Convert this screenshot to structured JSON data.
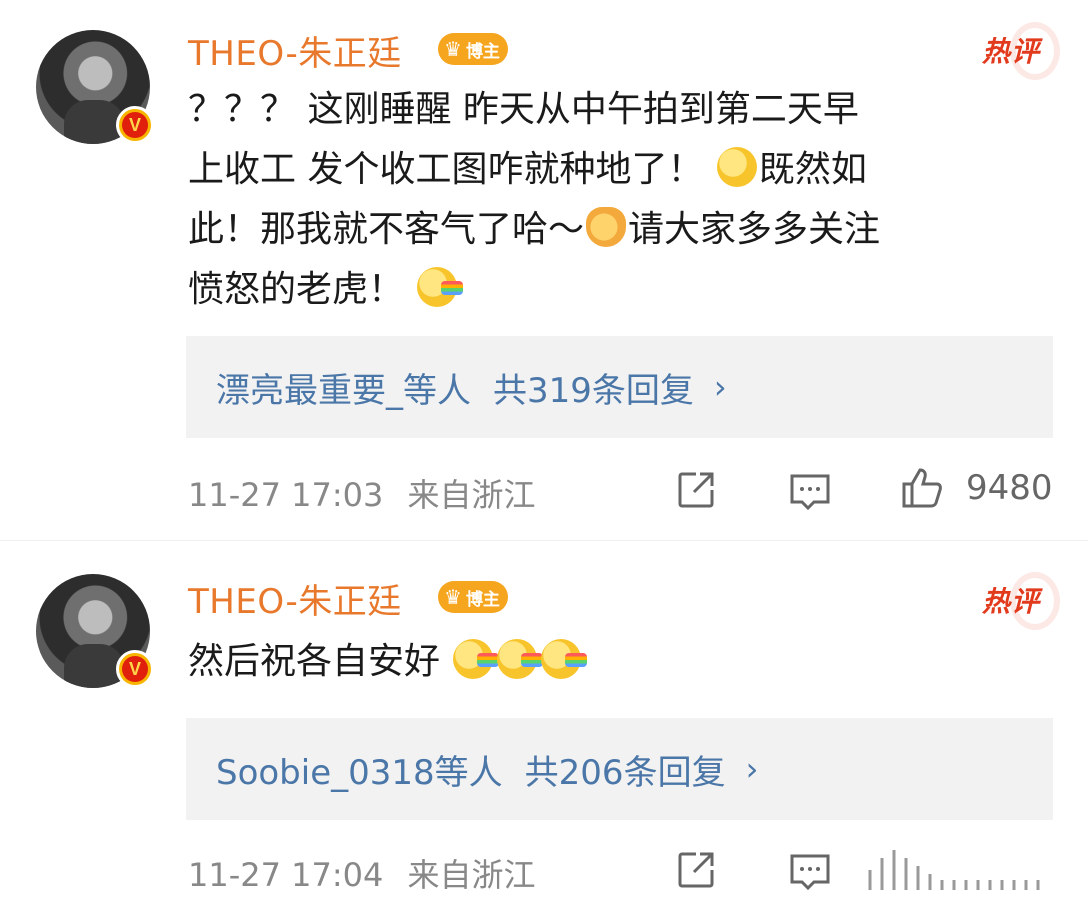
{
  "comments": [
    {
      "username": "THEO-朱正廷",
      "badge": "博主",
      "hot_tag": "热评",
      "text_lines": [
        "？？？ 这刚睡醒 昨天从中午拍到第二天早",
        "上收工 发个收工图咋就种地了！",
        "既然如",
        "此！那我就不客气了哈～",
        "请大家多多关注",
        "愤怒的老虎！"
      ],
      "replies_by": "漂亮最重要_等人",
      "replies_count": "共319条回复",
      "time": "11-27 17:03",
      "location": "来自浙江",
      "likes": "9480"
    },
    {
      "username": "THEO-朱正廷",
      "badge": "博主",
      "hot_tag": "热评",
      "text": "然后祝各自安好",
      "replies_by": "Soobie_0318等人",
      "replies_count": "共206条回复",
      "time": "11-27 17:04",
      "location": "来自浙江"
    }
  ],
  "icons": {
    "verified": "V",
    "crown": "♛",
    "chevron": "›"
  }
}
